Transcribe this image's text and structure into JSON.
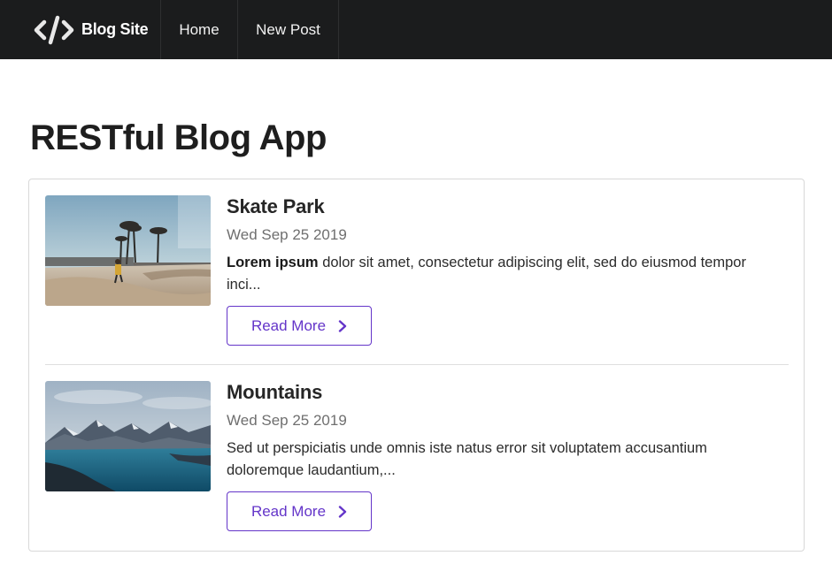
{
  "navbar": {
    "brand_icon": "code-icon",
    "brand_label": "Blog Site",
    "items": [
      {
        "label": "Home"
      },
      {
        "label": "New Post"
      }
    ]
  },
  "page": {
    "title": "RESTful Blog App"
  },
  "posts": [
    {
      "title": "Skate Park",
      "date": "Wed Sep 25 2019",
      "excerpt_bold": "Lorem ipsum",
      "excerpt_rest": " dolor sit amet, consectetur adipiscing elit, sed do eiusmod tempor inci...",
      "image": "skate-park-photo",
      "button_label": "Read More",
      "button_icon": "chevron-right-icon"
    },
    {
      "title": "Mountains",
      "date": "Wed Sep 25 2019",
      "excerpt_bold": "",
      "excerpt_rest": "Sed ut perspiciatis unde omnis iste natus error sit voluptatem accusantium doloremque laudantium,...",
      "image": "mountains-photo",
      "button_label": "Read More",
      "button_icon": "chevron-right-icon"
    }
  ],
  "colors": {
    "navbar_bg": "#1b1c1d",
    "accent": "#6435c9"
  }
}
